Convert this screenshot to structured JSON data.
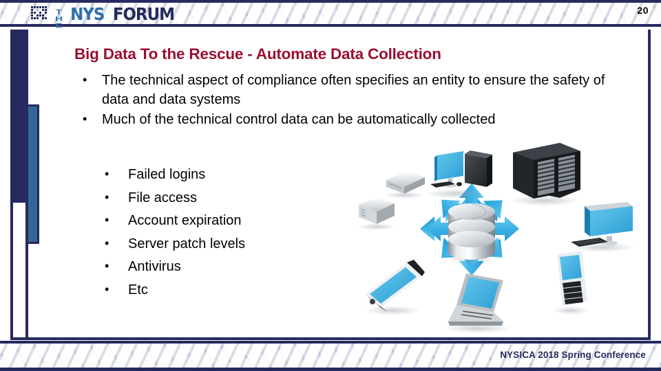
{
  "slide": {
    "page_number": "20",
    "title": "Big Data To the Rescue - Automate Data Collection"
  },
  "logo": {
    "mark": "pixel-grid-icon",
    "word_the": "THE",
    "word_nys": "NYS",
    "word_forum": "FORUM"
  },
  "body_bullets": [
    "The technical aspect of compliance often specifies an entity to ensure the safety of data and data systems",
    "Much of the technical control data can be automatically collected"
  ],
  "sub_bullets": [
    "Failed logins",
    "File access",
    "Account expiration",
    "Server patch levels",
    "Antivirus",
    "Etc"
  ],
  "footer": {
    "text": "NYSICA 2018 Spring Conference"
  },
  "diagram": {
    "center_node": "database-cylinder",
    "nodes": [
      "network-switch",
      "storage-appliance",
      "desktop-computer",
      "server-rack",
      "monitor-keyboard",
      "blackberry-phone",
      "laptop-computer",
      "smartphone"
    ],
    "connector": "double-headed-arrow",
    "arrow_color": "#41b6e6"
  },
  "colors": {
    "navy": "#262a5e",
    "blue_bar": "#336699",
    "title_red": "#9b0f30",
    "logo_blue": "#2f6fa8",
    "accent_cyan": "#41b6e6"
  }
}
